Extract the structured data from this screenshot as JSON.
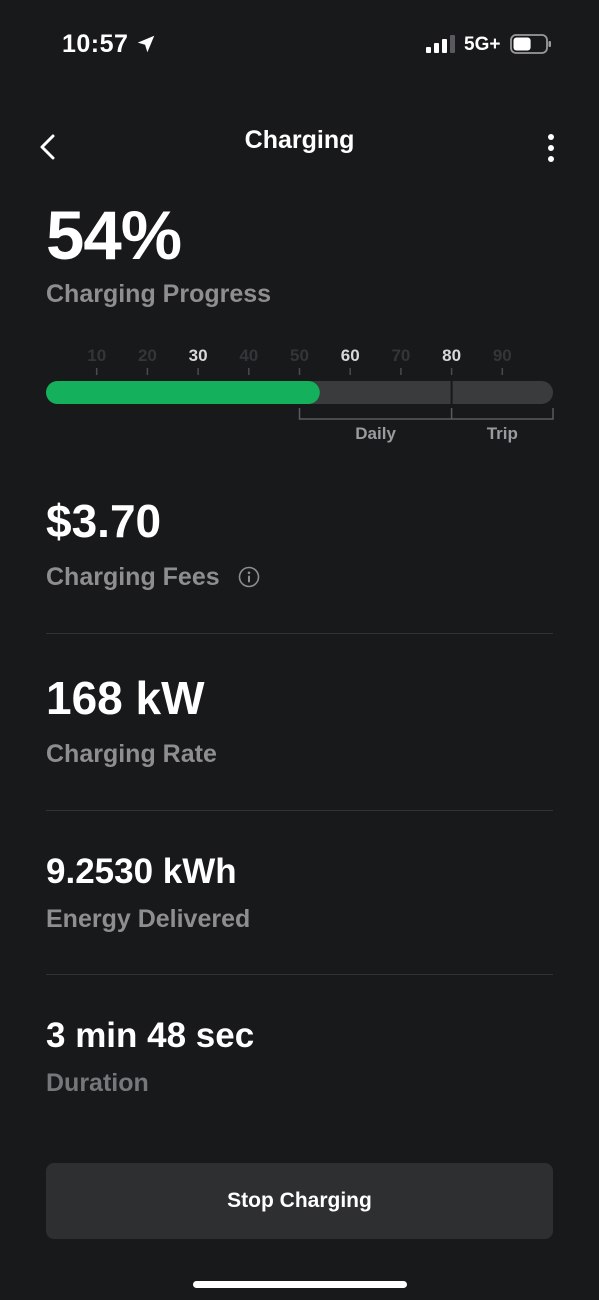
{
  "status_bar": {
    "time": "10:57",
    "network": "5G+",
    "signal_bars": 3,
    "signal_bars_total": 4,
    "battery_level": 0.55
  },
  "header": {
    "title": "Charging",
    "back_icon": "chevron-left-icon",
    "more_icon": "more-vertical-icon"
  },
  "progress": {
    "value_text": "54%",
    "label": "Charging Progress",
    "fraction": 0.54,
    "fill_color": "#14b05c",
    "track_color": "#3a3b3d",
    "ticks": [
      "10",
      "20",
      "30",
      "40",
      "50",
      "60",
      "70",
      "80",
      "90"
    ],
    "emphasized_ticks": [
      "30",
      "60",
      "80"
    ],
    "range_labels": {
      "daily": "Daily",
      "trip": "Trip"
    },
    "daily_start": 0.5,
    "daily_end": 0.8,
    "trip_end": 1.0
  },
  "fees": {
    "value": "$3.70",
    "label": "Charging Fees",
    "icon": "info-icon"
  },
  "rate": {
    "value": "168 kW",
    "label": "Charging Rate"
  },
  "energy": {
    "value": "9.2530 kWh",
    "label": "Energy Delivered"
  },
  "duration": {
    "value": "3 min 48 sec",
    "label": "Duration"
  },
  "actions": {
    "stop_label": "Stop Charging"
  },
  "colors": {
    "background": "#18191b",
    "accent_green": "#14b05c",
    "subtle_text": "#8e8e90",
    "button_bg": "#2e2f31"
  }
}
